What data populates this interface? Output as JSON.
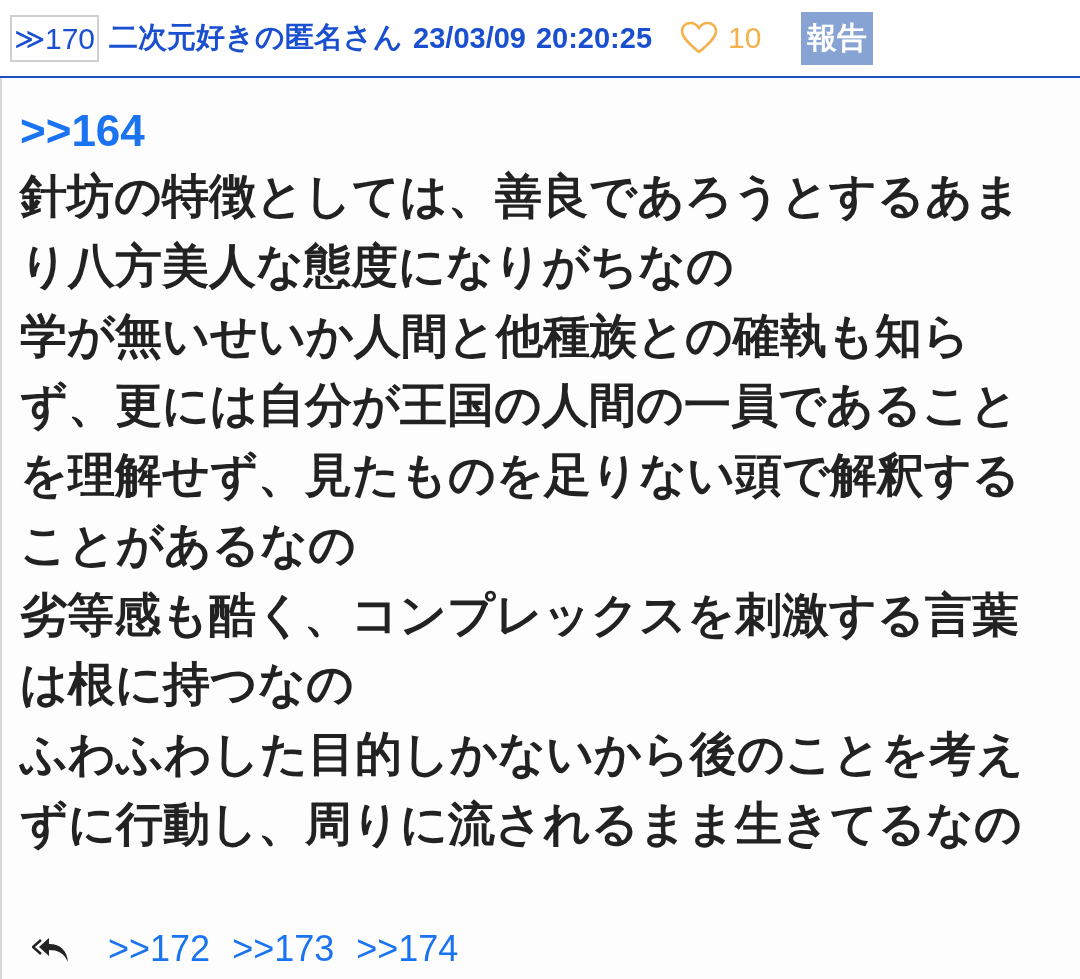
{
  "post": {
    "number": "≫170",
    "author": "二次元好きの匿名さん",
    "date": "23/03/09",
    "time": "20:20:25",
    "likes": "10",
    "report": "報告"
  },
  "body": {
    "anchor": ">>164",
    "paragraphs": [
      "針坊の特徴としては、善良であろうとするあまり八方美人な態度になりがちなの",
      "学が無いせいか人間と他種族との確執も知らず、更には自分が王国の人間の一員であることを理解せず、見たものを足りない頭で解釈することがあるなの",
      "劣等感も酷く、コンプレックスを刺激する言葉は根に持つなの",
      "ふわふわした目的しかないから後のことを考えずに行動し、周りに流されるまま生きてるなの"
    ]
  },
  "replies": [
    ">>172",
    ">>173",
    ">>174"
  ]
}
